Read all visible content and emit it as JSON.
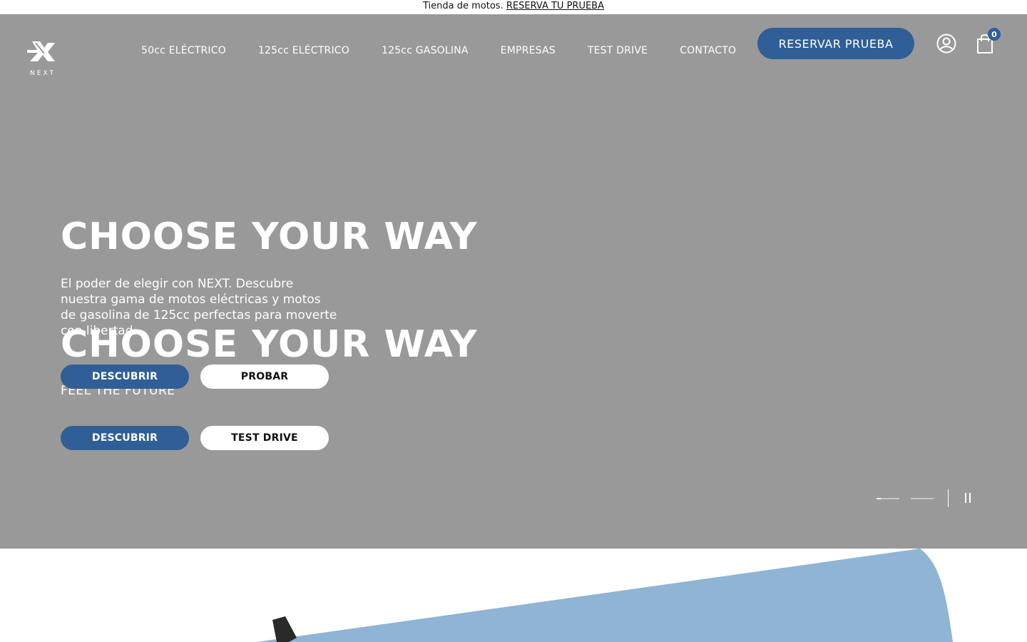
{
  "announcement": {
    "text": "Tienda de motos.",
    "link": "RESERVA TU PRUEBA"
  },
  "brand": {
    "name": "NEXT"
  },
  "nav": {
    "items": [
      "50cc ELÉCTRICO",
      "125cc ELÉCTRICO",
      "125cc GASOLINA",
      "EMPRESAS",
      "TEST DRIVE",
      "CONTACTO"
    ]
  },
  "header": {
    "reserve_label": "RESERVAR PRUEBA",
    "cart_count": "0"
  },
  "slides": [
    {
      "title": "CHOOSE YOUR WAY",
      "description": "El poder de elegir con NEXT. Descubre nuestra gama de motos eléctricas y motos de gasolina de 125cc perfectas para moverte con libertad.",
      "primary_button": "DESCUBRIR",
      "secondary_button": "PROBAR"
    },
    {
      "title": "CHOOSE YOUR WAY",
      "tagline": "FEEL THE FUTURE",
      "primary_button": "DESCUBRIR",
      "secondary_button": "TEST DRIVE"
    }
  ],
  "carousel": {
    "slide_count": 2,
    "active_index": 0,
    "active_progress": 0.2
  },
  "colors": {
    "hero_bg": "#999999",
    "accent_blue": "#2f5f96",
    "panel_blue": "#8fb4d4"
  }
}
